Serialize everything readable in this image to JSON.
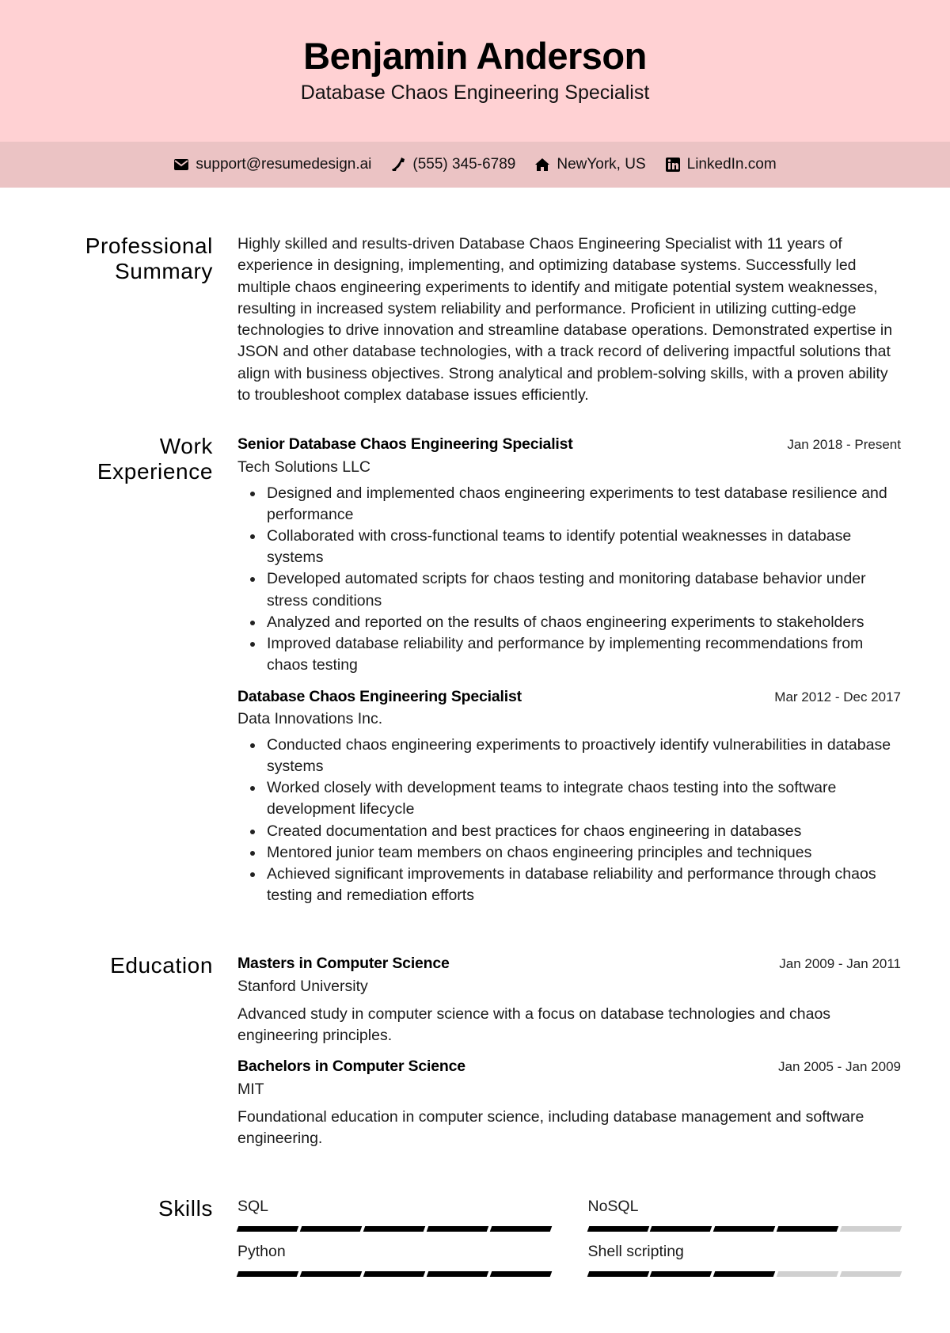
{
  "header": {
    "name": "Benjamin Anderson",
    "title": "Database Chaos Engineering Specialist"
  },
  "contact": [
    {
      "icon": "envelope-icon",
      "text": "support@resumedesign.ai"
    },
    {
      "icon": "phone-icon",
      "text": "(555) 345-6789"
    },
    {
      "icon": "home-icon",
      "text": "NewYork, US"
    },
    {
      "icon": "linkedin-icon",
      "text": "LinkedIn.com"
    }
  ],
  "summary": {
    "heading": "Professional Summary",
    "text": "Highly skilled and results-driven Database Chaos Engineering Specialist with 11 years of experience in designing, implementing, and optimizing database systems. Successfully led multiple chaos engineering experiments to identify and mitigate potential system weaknesses, resulting in increased system reliability and performance. Proficient in utilizing cutting-edge technologies to drive innovation and streamline database operations. Demonstrated expertise in JSON and other database technologies, with a track record of delivering impactful solutions that align with business objectives. Strong analytical and problem-solving skills, with a proven ability to troubleshoot complex database issues efficiently."
  },
  "work": {
    "heading": "Work Experience",
    "entries": [
      {
        "role": "Senior Database Chaos Engineering Specialist",
        "dates": "Jan 2018 - Present",
        "org": "Tech Solutions LLC",
        "bullets": [
          "Designed and implemented chaos engineering experiments to test database resilience and performance",
          "Collaborated with cross-functional teams to identify potential weaknesses in database systems",
          "Developed automated scripts for chaos testing and monitoring database behavior under stress conditions",
          "Analyzed and reported on the results of chaos engineering experiments to stakeholders",
          "Improved database reliability and performance by implementing recommendations from chaos testing"
        ]
      },
      {
        "role": "Database Chaos Engineering Specialist",
        "dates": "Mar 2012 - Dec 2017",
        "org": "Data Innovations Inc.",
        "bullets": [
          "Conducted chaos engineering experiments to proactively identify vulnerabilities in database systems",
          "Worked closely with development teams to integrate chaos testing into the software development lifecycle",
          "Created documentation and best practices for chaos engineering in databases",
          "Mentored junior team members on chaos engineering principles and techniques",
          "Achieved significant improvements in database reliability and performance through chaos testing and remediation efforts"
        ]
      }
    ]
  },
  "education": {
    "heading": "Education",
    "entries": [
      {
        "degree": "Masters in Computer Science",
        "dates": "Jan 2009 - Jan 2011",
        "school": "Stanford University",
        "desc": "Advanced study in computer science with a focus on database technologies and chaos engineering principles."
      },
      {
        "degree": "Bachelors in Computer Science",
        "dates": "Jan 2005 - Jan 2009",
        "school": "MIT",
        "desc": "Foundational education in computer science, including database management and software engineering."
      }
    ]
  },
  "skills": {
    "heading": "Skills",
    "max_level": 5,
    "items": [
      {
        "name": "SQL",
        "level": 5
      },
      {
        "name": "NoSQL",
        "level": 4
      },
      {
        "name": "Python",
        "level": 5
      },
      {
        "name": "Shell scripting",
        "level": 3
      }
    ]
  }
}
